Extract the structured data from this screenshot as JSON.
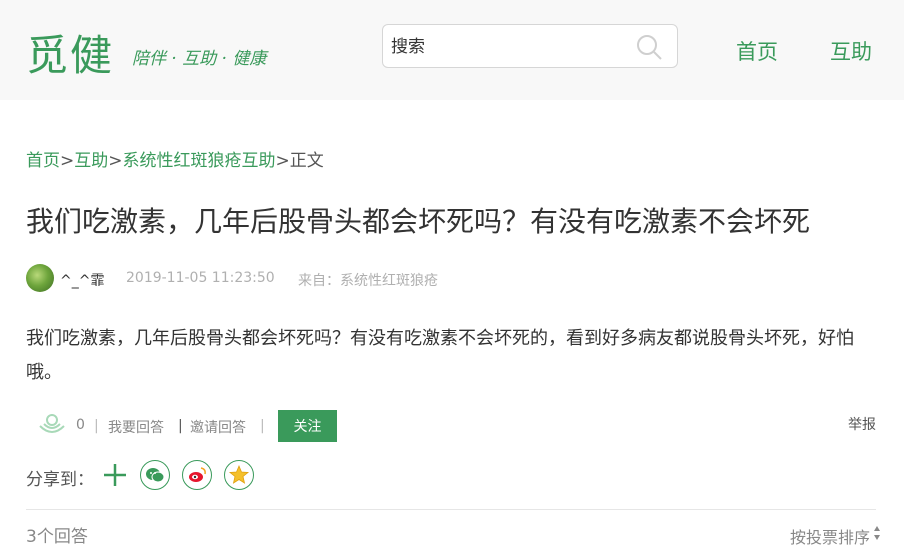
{
  "header": {
    "logo": "觅健",
    "slogan": "陪伴 · 互助 · 健康",
    "search_placeholder": "搜索",
    "nav": {
      "home": "首页",
      "help": "互助"
    }
  },
  "breadcrumb": {
    "home": "首页",
    "help": "互助",
    "group": "系统性红斑狼疮互助",
    "current": "正文",
    "separator": ">"
  },
  "post": {
    "title": "我们吃激素，几年后股骨头都会坏死吗？有没有吃激素不会坏死",
    "author": "^_^霏",
    "date": "2019-11-05 11:23:50",
    "source": "来自：系统性红斑狼疮",
    "body": "我们吃激素，几年后股骨头都会坏死吗？有没有吃激素不会坏死的，看到好多病友都说股骨头坏死，好怕哦。"
  },
  "actions": {
    "like_count": "0",
    "answer": "我要回答",
    "invite": "邀请回答",
    "follow": "关注",
    "report": "举报",
    "divider": "|"
  },
  "share": {
    "label": "分享到："
  },
  "answers": {
    "count_label": "3个回答",
    "sort_label": "按投票排序"
  },
  "colors": {
    "accent": "#3a9a5b",
    "text": "#333333",
    "muted": "#888888"
  }
}
